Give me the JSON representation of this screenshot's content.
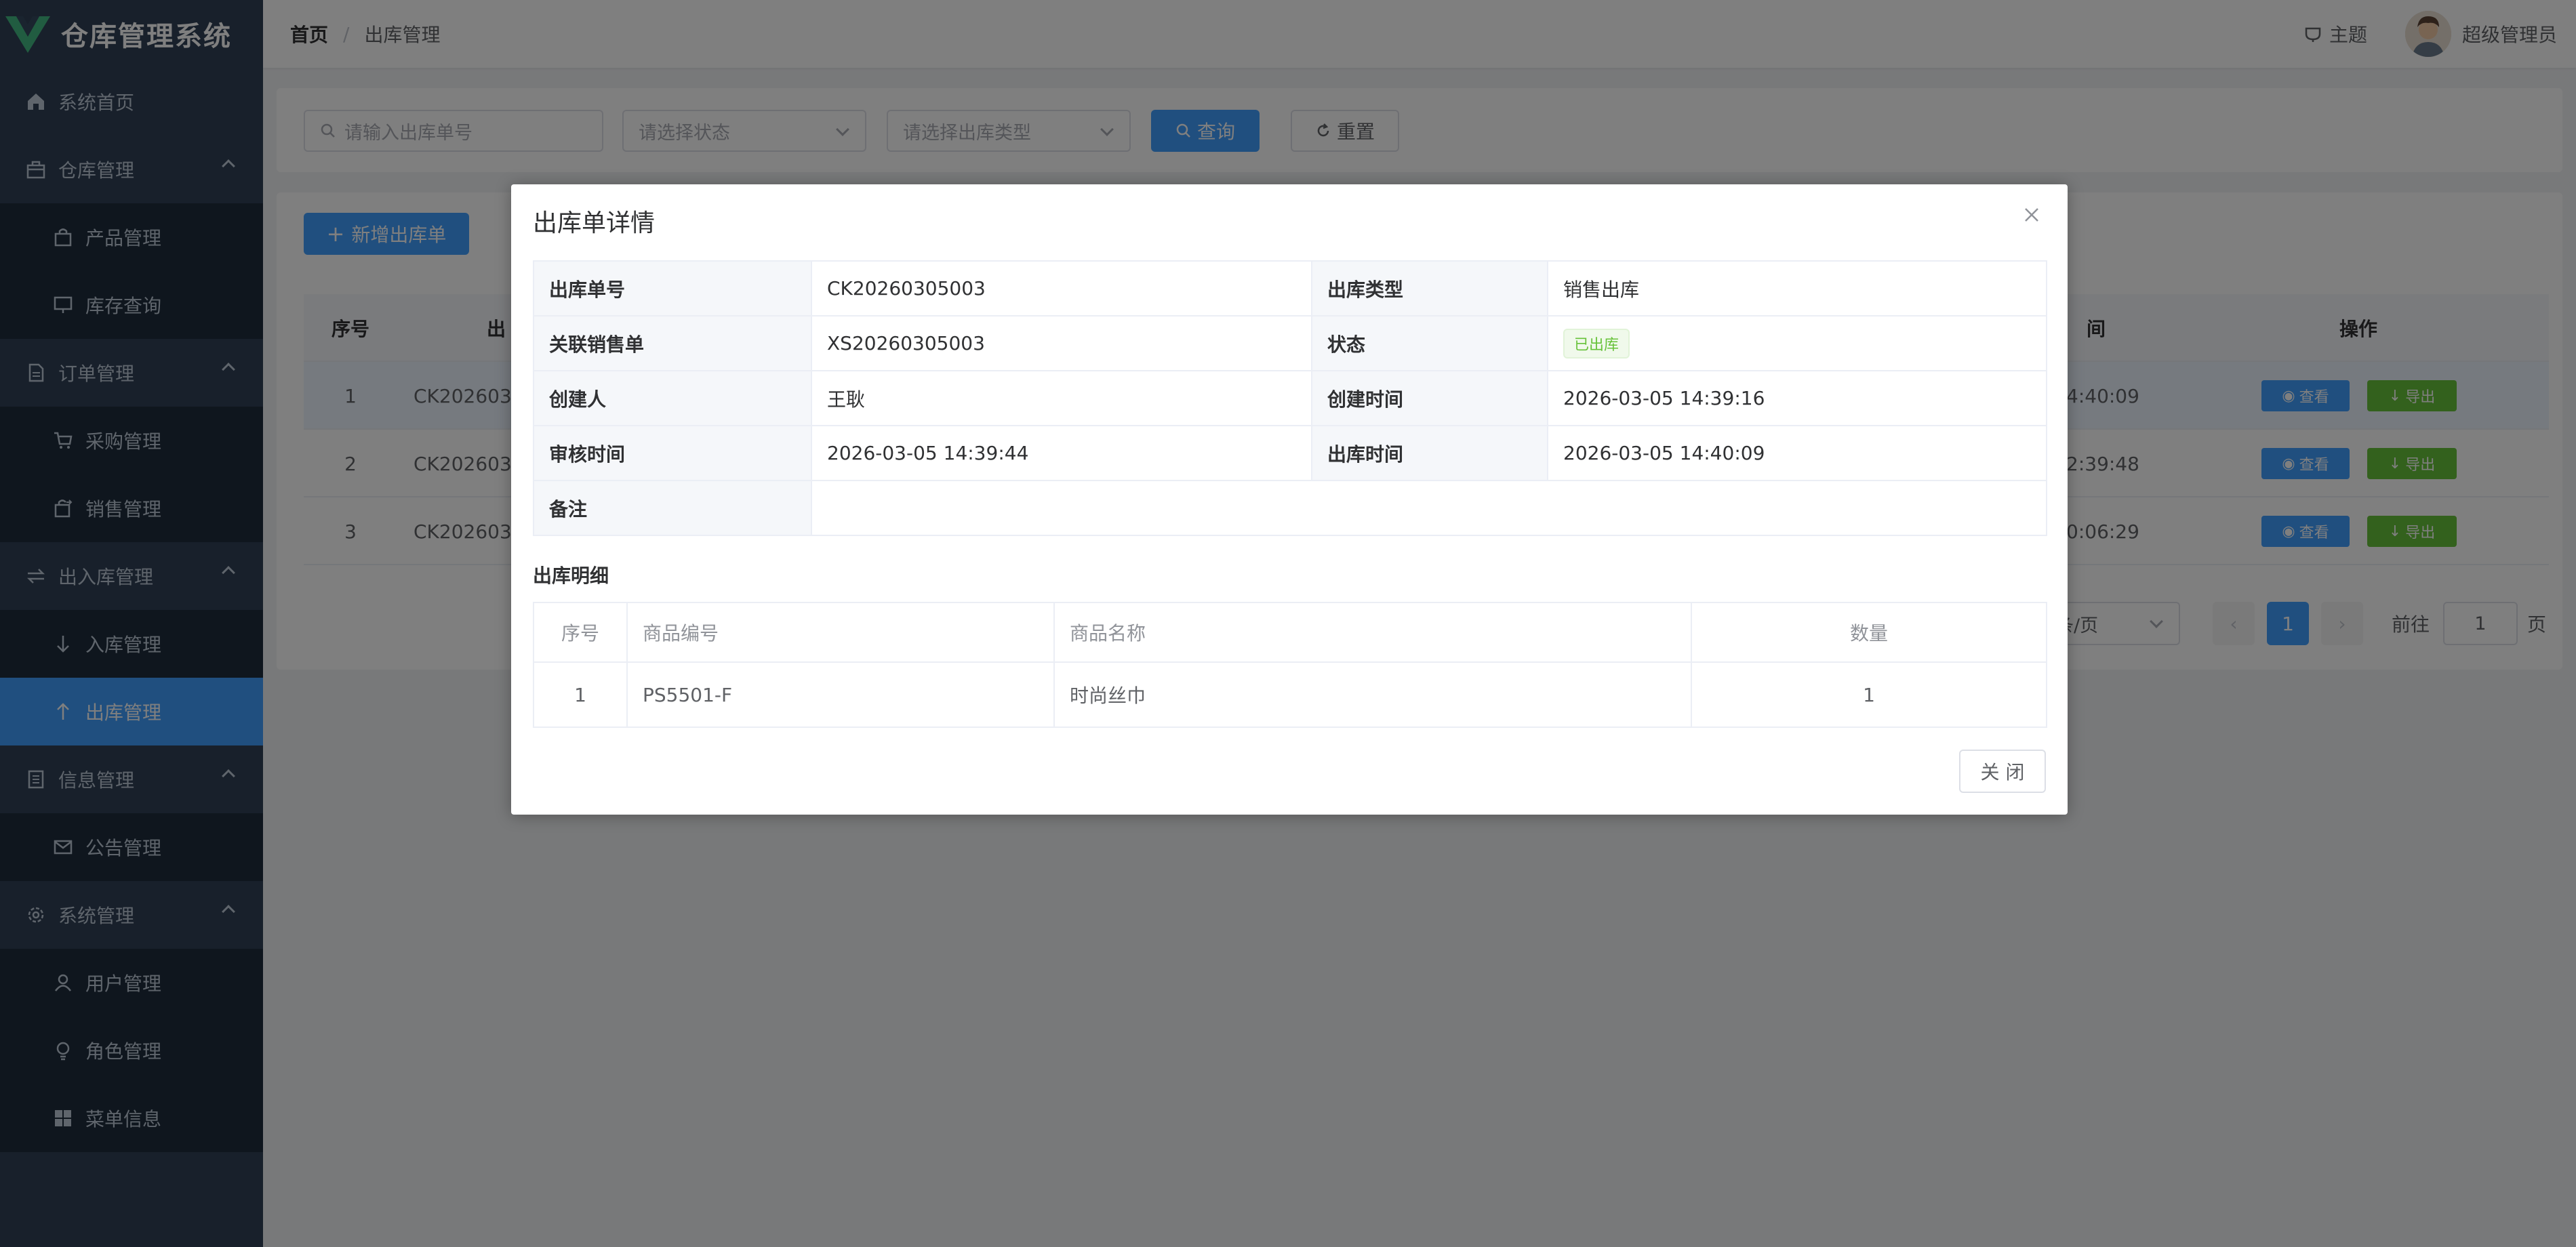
{
  "app": {
    "title": "仓库管理系统",
    "logo_color": "#42b983"
  },
  "sidebar": {
    "items": [
      {
        "label": "系统首页",
        "icon": "home-icon",
        "level": 1
      },
      {
        "label": "仓库管理",
        "icon": "package-icon",
        "level": 1,
        "expanded": true
      },
      {
        "label": "产品管理",
        "icon": "bag-icon",
        "level": 2
      },
      {
        "label": "库存查询",
        "icon": "monitor-icon",
        "level": 2
      },
      {
        "label": "订单管理",
        "icon": "document-icon",
        "level": 1,
        "expanded": true
      },
      {
        "label": "采购管理",
        "icon": "cart-icon",
        "level": 2
      },
      {
        "label": "销售管理",
        "icon": "export-bag-icon",
        "level": 2
      },
      {
        "label": "出入库管理",
        "icon": "switch-icon",
        "level": 1,
        "expanded": true
      },
      {
        "label": "入库管理",
        "icon": "arrow-down-icon",
        "level": 2
      },
      {
        "label": "出库管理",
        "icon": "arrow-up-icon",
        "level": 2,
        "active": true
      },
      {
        "label": "信息管理",
        "icon": "tickets-icon",
        "level": 1,
        "expanded": true
      },
      {
        "label": "公告管理",
        "icon": "message-icon",
        "level": 2
      },
      {
        "label": "系统管理",
        "icon": "setting-icon",
        "level": 1,
        "expanded": true
      },
      {
        "label": "用户管理",
        "icon": "user-icon",
        "level": 2
      },
      {
        "label": "角色管理",
        "icon": "bulb-icon",
        "level": 2
      },
      {
        "label": "菜单信息",
        "icon": "grid-icon",
        "level": 2
      }
    ]
  },
  "header": {
    "breadcrumb": [
      "首页",
      "出库管理"
    ],
    "theme_label": "主题",
    "username": "超级管理员"
  },
  "search": {
    "order_no_placeholder": "请输入出库单号",
    "status_placeholder": "请选择状态",
    "type_placeholder": "请选择出库类型",
    "query_label": "查询",
    "reset_label": "重置"
  },
  "toolbar": {
    "add_label": "新增出库单"
  },
  "table": {
    "headers": {
      "index": "序号",
      "order_no": "出",
      "time": "间",
      "actions": "操作"
    },
    "rows": [
      {
        "index": "1",
        "order_no": "CK202603",
        "time": "4:40:09"
      },
      {
        "index": "2",
        "order_no": "CK202603",
        "time": "2:39:48"
      },
      {
        "index": "3",
        "order_no": "CK202603",
        "time": "0:06:29"
      }
    ],
    "view_label": "查看",
    "export_label": "导出"
  },
  "pagination": {
    "page_size_text": "条/页",
    "current_page": "1",
    "goto_label": "前往",
    "goto_value": "1",
    "page_unit": "页"
  },
  "dialog": {
    "title": "出库单详情",
    "fields": {
      "order_no_label": "出库单号",
      "order_no": "CK20260305003",
      "type_label": "出库类型",
      "type": "销售出库",
      "sales_label": "关联销售单",
      "sales": "XS20260305003",
      "status_label": "状态",
      "status": "已出库",
      "creator_label": "创建人",
      "creator": "王耿",
      "created_label": "创建时间",
      "created": "2026-03-05 14:39:16",
      "audit_label": "审核时间",
      "audit": "2026-03-05 14:39:44",
      "out_label": "出库时间",
      "out": "2026-03-05 14:40:09",
      "remark_label": "备注",
      "remark": ""
    },
    "detail_title": "出库明细",
    "detail_headers": {
      "index": "序号",
      "code": "商品编号",
      "name": "商品名称",
      "qty": "数量"
    },
    "detail_rows": [
      {
        "index": "1",
        "code": "PS5501-F",
        "name": "时尚丝巾",
        "qty": "1"
      }
    ],
    "close_label": "关 闭"
  }
}
